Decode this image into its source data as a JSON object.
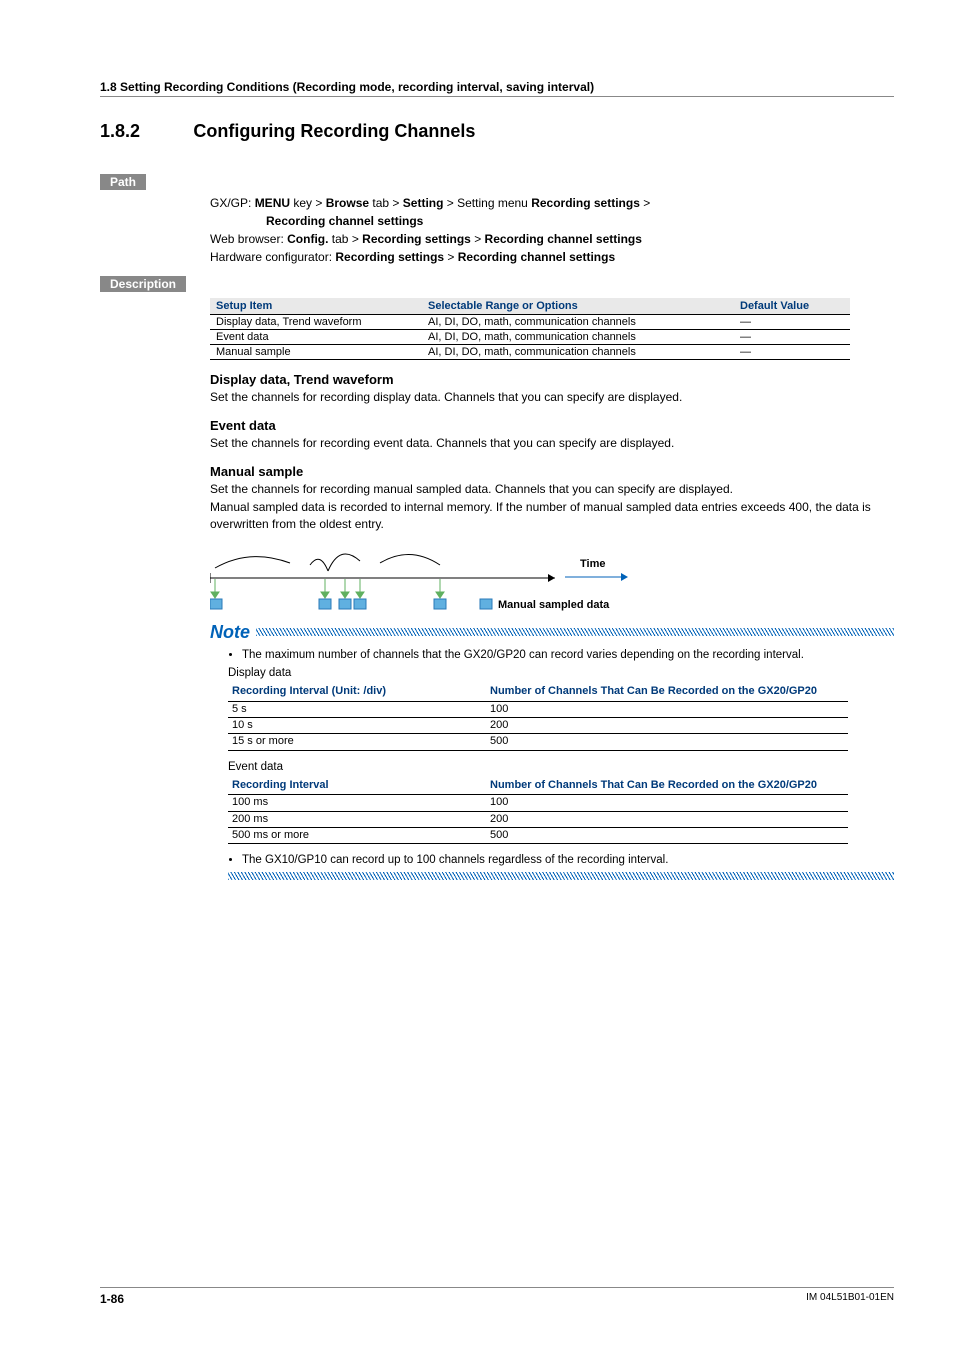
{
  "header": "1.8  Setting Recording Conditions (Recording mode, recording interval, saving interval)",
  "section": {
    "num": "1.8.2",
    "title": "Configuring Recording Channels"
  },
  "path_label": "Path",
  "path": {
    "gx_prefix": "GX/GP: ",
    "gx_parts": [
      "MENU",
      " key > ",
      "Browse",
      " tab > ",
      "Setting",
      " > Setting menu ",
      "Recording settings",
      " > "
    ],
    "gx_line2": "Recording channel settings",
    "web_prefix": "Web browser: ",
    "web_parts": [
      "Config.",
      " tab > ",
      "Recording settings",
      " > ",
      "Recording channel settings"
    ],
    "hw_prefix": "Hardware configurator: ",
    "hw_parts": [
      "Recording settings",
      " > ",
      "Recording channel settings"
    ]
  },
  "desc_label": "Description",
  "table_headers": [
    "Setup Item",
    "Selectable Range or Options",
    "Default Value"
  ],
  "table_rows": [
    [
      "Display data, Trend waveform",
      "AI, DI, DO, math, communication channels",
      "—"
    ],
    [
      "Event data",
      "AI, DI, DO, math, communication channels",
      "—"
    ],
    [
      "Manual sample",
      "AI, DI, DO, math, communication channels",
      "—"
    ]
  ],
  "sections": {
    "display": {
      "title": "Display data, Trend waveform",
      "body": "Set the channels for recording display data. Channels that you can specify are displayed."
    },
    "event": {
      "title": "Event data",
      "body": "Set the channels for recording event data. Channels that you can specify are displayed."
    },
    "manual": {
      "title": "Manual sample",
      "body1": "Set the channels for recording manual sampled data. Channels that you can specify are displayed.",
      "body2": "Manual sampled data is recorded to internal memory. If the number of manual sampled data entries exceeds 400, the data is overwritten from the oldest entry."
    }
  },
  "diagram": {
    "time_label": "Time",
    "legend": "Manual sampled data"
  },
  "note": {
    "title": "Note",
    "bullet1": "The maximum number of channels that the GX20/GP20 can record varies depending on the recording interval.",
    "display_caption": "Display data",
    "display_headers": [
      "Recording Interval (Unit: /div)",
      "Number of Channels That Can Be Recorded on the GX20/GP20"
    ],
    "display_rows": [
      [
        "5 s",
        "100"
      ],
      [
        "10 s",
        "200"
      ],
      [
        "15 s or more",
        "500"
      ]
    ],
    "event_caption": "Event data",
    "event_headers": [
      "Recording Interval",
      "Number of Channels That Can Be Recorded on the GX20/GP20"
    ],
    "event_rows": [
      [
        "100 ms",
        "100"
      ],
      [
        "200 ms",
        "200"
      ],
      [
        "500 ms or more",
        "500"
      ]
    ],
    "bullet2": "The GX10/GP10 can record up to 100 channels regardless of the recording interval."
  },
  "footer": {
    "page": "1-86",
    "doc": "IM 04L51B01-01EN"
  }
}
